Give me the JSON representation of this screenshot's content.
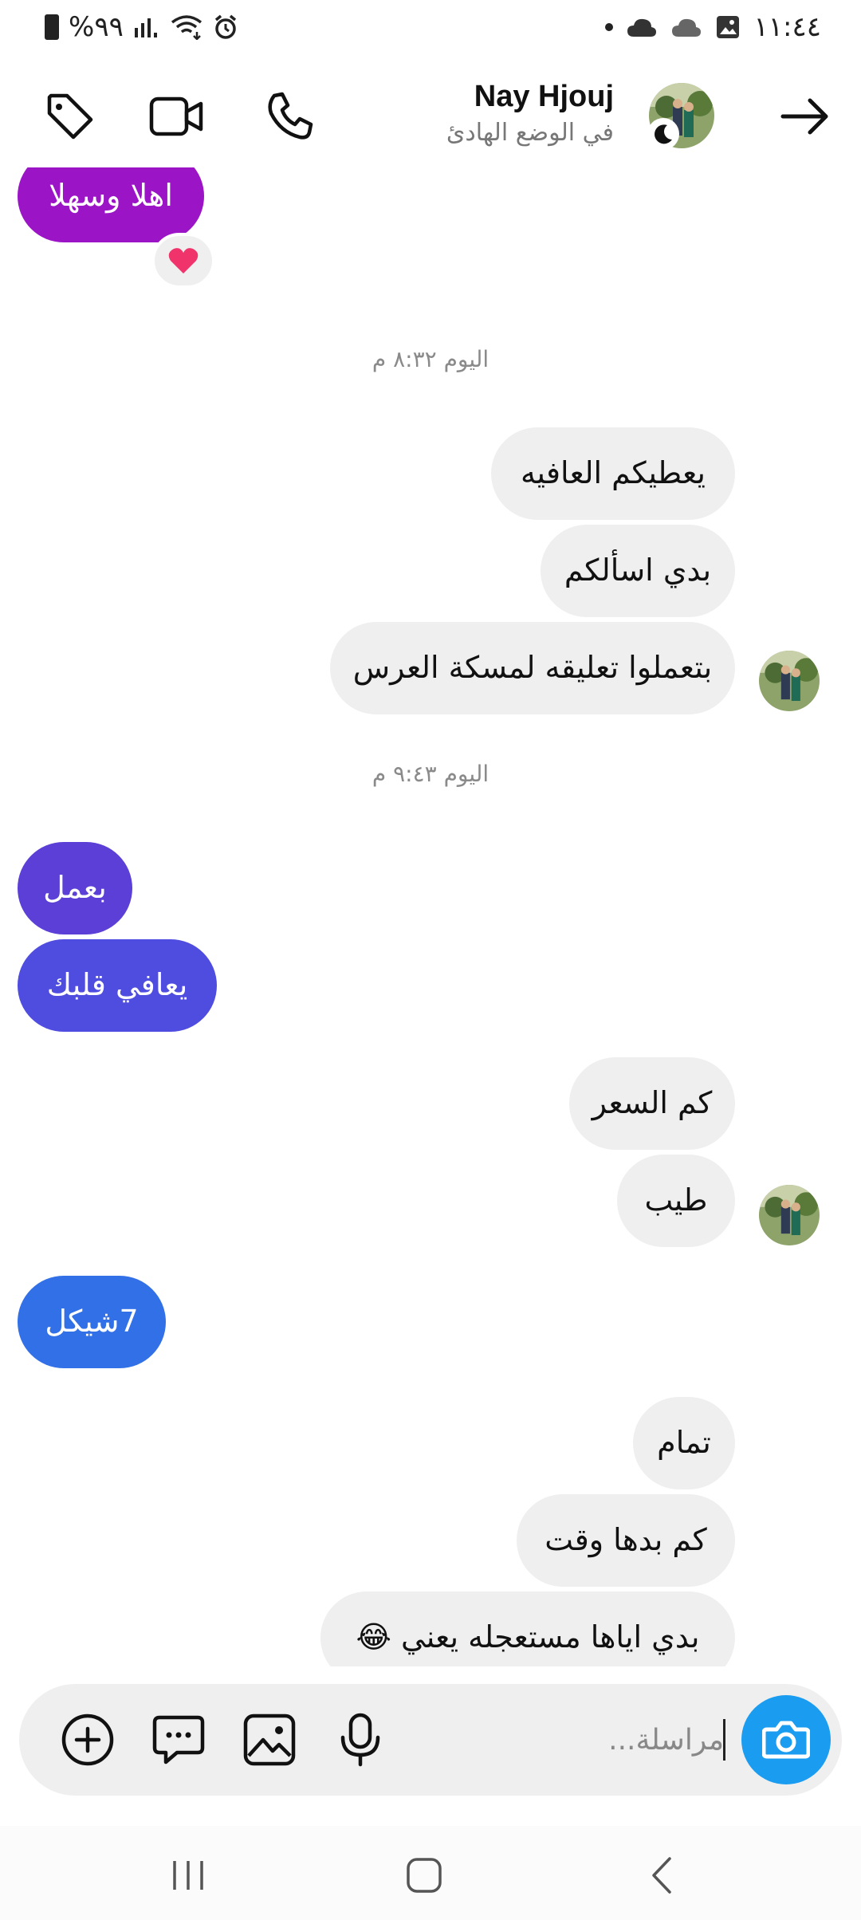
{
  "status_bar": {
    "battery_text": "%٩٩",
    "time": "١١:٤٤"
  },
  "header": {
    "name": "Nay Hjouj",
    "status": "في الوضع الهادئ"
  },
  "timestamps": {
    "first": "اليوم ٨:٣٢ م",
    "second": "اليوم ٩:٤٣ م"
  },
  "messages": {
    "m1": "اهلا وسهلا",
    "m2": "يعطيكم العافيه",
    "m3": "بدي اسألكم",
    "m4": "بتعملوا تعليقه لمسكة العرس",
    "m5": "بعمل",
    "m6": "يعافي قلبك",
    "m7": "كم السعر",
    "m8": "طيب",
    "m9": "7شيكل",
    "m10": "تمام",
    "m11": "كم بدها وقت",
    "m12": "بدي اياها مستعجله يعني 😂"
  },
  "reaction_emoji": "❤️",
  "composer": {
    "placeholder": "مراسلة..."
  },
  "colors": {
    "bubble_purple": "#9b14c6",
    "bubble_violet": "#5b3fd6",
    "bubble_blue": "#3270e8",
    "incoming": "#efefef",
    "camera_button": "#1a9df0"
  }
}
